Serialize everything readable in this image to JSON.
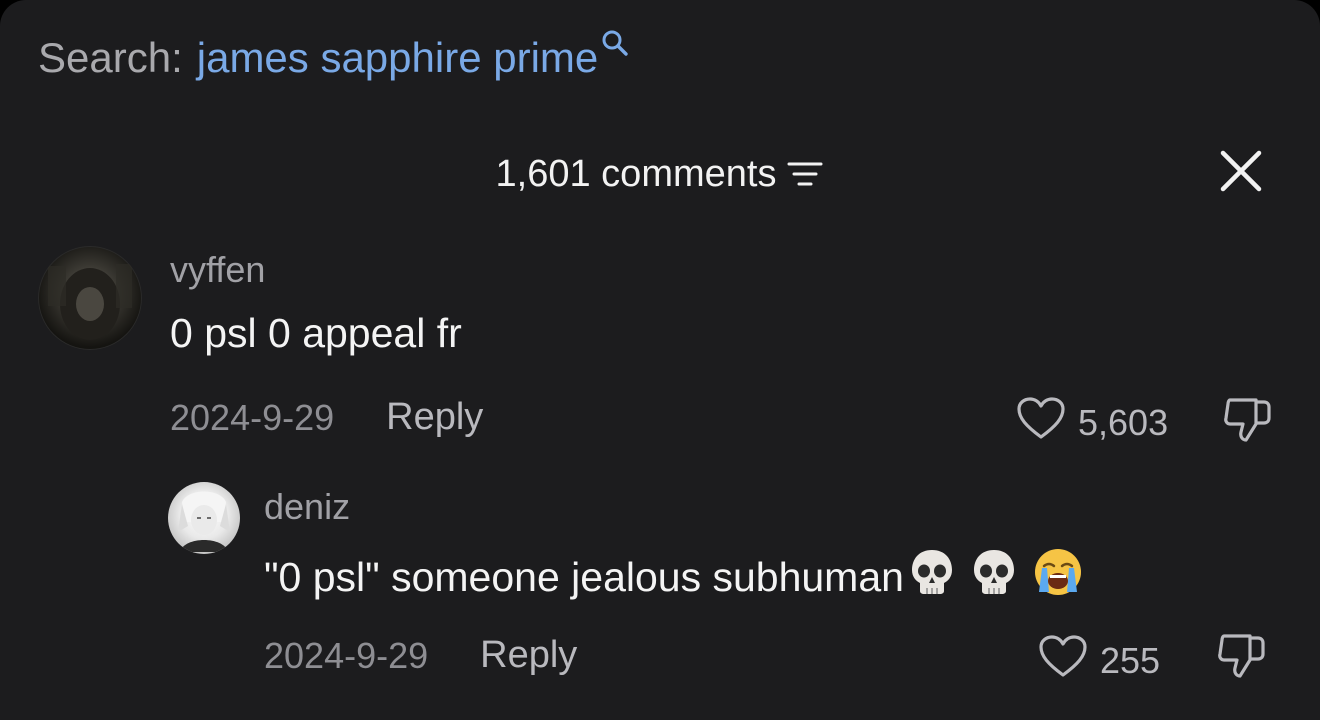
{
  "search": {
    "prefix": "Search:",
    "query": "james sapphire prime",
    "icon": "search-icon",
    "query_color": "#7aa9e6"
  },
  "header": {
    "count_label": "1,601 comments",
    "sort_icon": "sort-icon",
    "close_icon": "close-icon"
  },
  "comments": [
    {
      "username": "vyffen",
      "text": "0 psl 0 appeal fr",
      "date": "2024-9-29",
      "reply_label": "Reply",
      "likes": "5,603"
    },
    {
      "username": "deniz",
      "text": "\"0 psl\" someone jealous subhuman",
      "emojis": [
        "skull-emoji",
        "skull-emoji",
        "loudly-crying-face-emoji"
      ],
      "date": "2024-9-29",
      "reply_label": "Reply",
      "likes": "255"
    }
  ],
  "colors": {
    "background": "#1c1c1e",
    "primary_text": "#f4f4f4",
    "secondary_text": "#a1a1a6",
    "link": "#7aa9e6"
  }
}
